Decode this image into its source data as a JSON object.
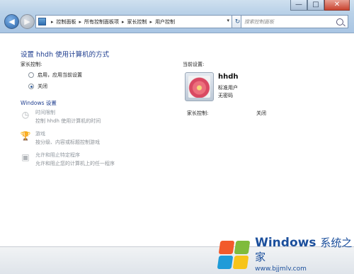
{
  "window": {
    "min_symbol": "—",
    "max_symbol": "□",
    "close_symbol": "✕"
  },
  "nav": {
    "back_symbol": "◀",
    "forward_symbol": "▶",
    "dropdown_symbol": "▾"
  },
  "breadcrumb": [
    "控制面板",
    "所有控制面板项",
    "家长控制",
    "用户控制"
  ],
  "breadcrumb_separator": "▸",
  "address_dropdown": "▾",
  "refresh_symbol": "↻",
  "search": {
    "placeholder": "搜索控制面板"
  },
  "page": {
    "title": "设置 hhdh 使用计算机的方式",
    "parental_label": "家长控制:",
    "options": [
      {
        "label": "启用，应用当前设置",
        "selected": false
      },
      {
        "label": "关闭",
        "selected": true
      }
    ],
    "windows_settings_title": "Windows 设置",
    "settings_items": [
      {
        "icon": "clock-icon",
        "title": "时间限制",
        "desc": "控制 hhdh 使用计算机的时间"
      },
      {
        "icon": "trophy-icon",
        "title": "游戏",
        "desc": "按分级、内容或标题控制游戏"
      },
      {
        "icon": "program-icon",
        "title": "允许和阻止特定程序",
        "desc": "允许和阻止您的计算机上的任一程序"
      }
    ],
    "current_settings_label": "当前设置:",
    "user": {
      "name": "hhdh",
      "type": "标准用户",
      "password": "无密码"
    },
    "parental_status_label": "家长控制:",
    "parental_status_value": "关闭"
  },
  "watermark": {
    "brand": "Windows",
    "suffix": "系统之家",
    "url": "www.bjjmlv.com"
  },
  "colors": {
    "title_blue": "#1e3d8f",
    "titlebar": "#b9d1e8"
  }
}
